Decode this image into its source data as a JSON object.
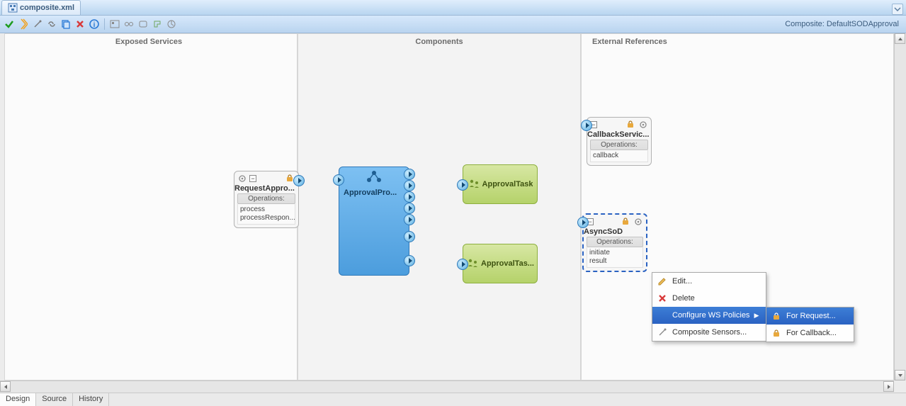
{
  "tab": {
    "filename": "composite.xml"
  },
  "toolbar": {
    "label": "Composite:",
    "composite_name": "DefaultSODApproval"
  },
  "lanes": {
    "services": "Exposed Services",
    "components": "Components",
    "references": "External References"
  },
  "nodes": {
    "requestAppro": {
      "title": "RequestAppro...",
      "ops_header": "Operations:",
      "ops": [
        "process",
        "processRespon..."
      ]
    },
    "approvalPro": {
      "title": "ApprovalPro..."
    },
    "approvalTask1": {
      "title": "ApprovalTask"
    },
    "approvalTask2": {
      "title": "ApprovalTas..."
    },
    "callbackServic": {
      "title": "CallbackServic...",
      "ops_header": "Operations:",
      "ops": [
        "callback"
      ]
    },
    "asyncSoD": {
      "title": "AsyncSoD",
      "ops_header": "Operations:",
      "ops": [
        "initiate",
        "result"
      ]
    }
  },
  "context_menu": {
    "edit": "Edit...",
    "delete": "Delete",
    "configure_ws": "Configure WS Policies",
    "composite_sensors": "Composite Sensors...",
    "for_request": "For Request...",
    "for_callback": "For Callback..."
  },
  "bottom_tabs": [
    "Design",
    "Source",
    "History"
  ]
}
